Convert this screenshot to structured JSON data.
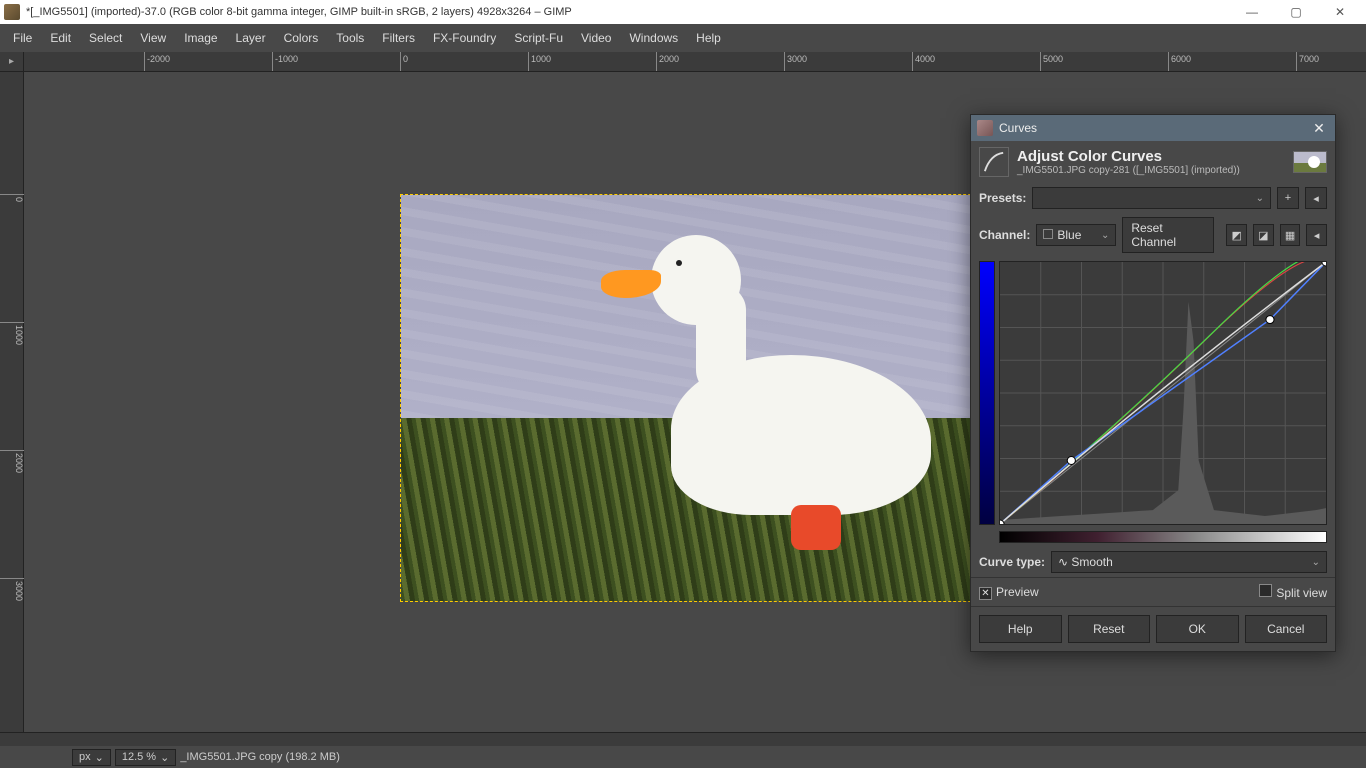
{
  "titlebar": {
    "text": "*[_IMG5501] (imported)-37.0 (RGB color 8-bit gamma integer, GIMP built-in sRGB, 2 layers) 4928x3264 – GIMP"
  },
  "menu": [
    "File",
    "Edit",
    "Select",
    "View",
    "Image",
    "Layer",
    "Colors",
    "Tools",
    "Filters",
    "FX-Foundry",
    "Script-Fu",
    "Video",
    "Windows",
    "Help"
  ],
  "ruler_h": [
    "-2000",
    "-1000",
    "0",
    "1000",
    "2000",
    "3000",
    "4000",
    "5000",
    "6000",
    "7000"
  ],
  "ruler_v": [
    "0",
    "1000",
    "2000",
    "3000"
  ],
  "status": {
    "unit": "px",
    "zoom": "12.5 %",
    "message": "_IMG5501.JPG copy (198.2 MB)"
  },
  "dialog": {
    "title": "Curves",
    "header_title": "Adjust Color Curves",
    "header_sub": "_IMG5501.JPG copy-281 ([_IMG5501] (imported))",
    "presets_label": "Presets:",
    "channel_label": "Channel:",
    "channel_value": "Blue",
    "reset_channel": "Reset Channel",
    "curve_type_label": "Curve type:",
    "curve_type_value": "Smooth",
    "preview_label": "Preview",
    "split_label": "Split view",
    "buttons": {
      "help": "Help",
      "reset": "Reset",
      "ok": "OK",
      "cancel": "Cancel"
    }
  }
}
